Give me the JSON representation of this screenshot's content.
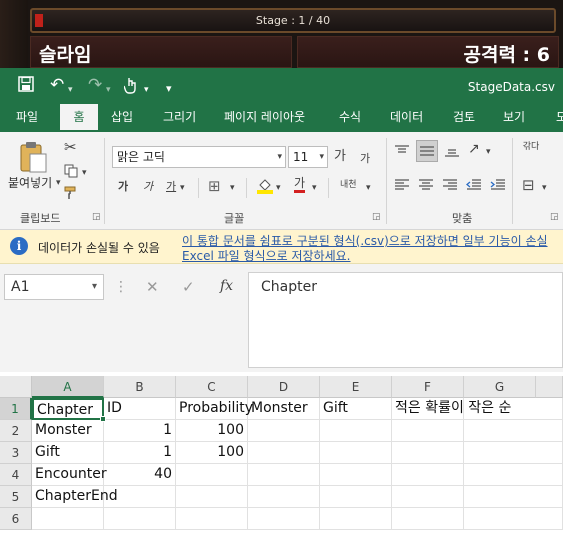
{
  "game": {
    "stage_text": "Stage : 1 / 40",
    "monster_name": "슬라임",
    "attack_text": "공격력 : 6"
  },
  "titlebar": {
    "filename": "StageData.csv"
  },
  "tabs": [
    "파일",
    "홈",
    "삽입",
    "그리기",
    "페이지 레이아웃",
    "수식",
    "데이터",
    "검토",
    "보기",
    "도"
  ],
  "active_tab": "홈",
  "ribbon": {
    "paste_label": "붙여넣기",
    "clipboard_label": "클립보드",
    "font_name": "맑은 고딕",
    "font_size": "11",
    "font_group_label": "글꼴",
    "align_group_label": "맞춤",
    "grow_font": "가",
    "shrink_font": "가",
    "bold": "가",
    "italic": "가",
    "underline": "가",
    "phonetic": "내천",
    "font_color_glyph": "가",
    "wrap_text": "갂다"
  },
  "warning": {
    "title": "데이터가 손실될 수 있음",
    "line1": "이 통합 문서를 쉼표로 구분된 형식(.csv)으로 저장하면 일부 기능이 손실",
    "line2": "Excel 파일 형식으로 저장하세요."
  },
  "formula_bar": {
    "name_box": "A1",
    "content": "Chapter"
  },
  "sheet": {
    "columns": [
      "A",
      "B",
      "C",
      "D",
      "E",
      "F",
      "G"
    ],
    "selected_column": "A",
    "rows": [
      "1",
      "2",
      "3",
      "4",
      "5",
      "6"
    ],
    "selected_row": "1",
    "cells": [
      [
        "Chapter",
        "ID",
        "Probability",
        "Monster",
        "Gift",
        "적은 확률이 작은 순",
        ""
      ],
      [
        "Monster",
        "1",
        "100",
        "",
        "",
        "",
        ""
      ],
      [
        "Gift",
        "1",
        "100",
        "",
        "",
        "",
        ""
      ],
      [
        "Encounter",
        "40",
        "",
        "",
        "",
        "",
        ""
      ],
      [
        "ChapterEnd",
        "",
        "",
        "",
        "",
        "",
        ""
      ],
      [
        "",
        "",
        "",
        "",
        "",
        "",
        ""
      ]
    ]
  },
  "colors": {
    "excel_green": "#217346",
    "warning_bg": "#fff4ce",
    "link_blue": "#2a5aa8"
  }
}
